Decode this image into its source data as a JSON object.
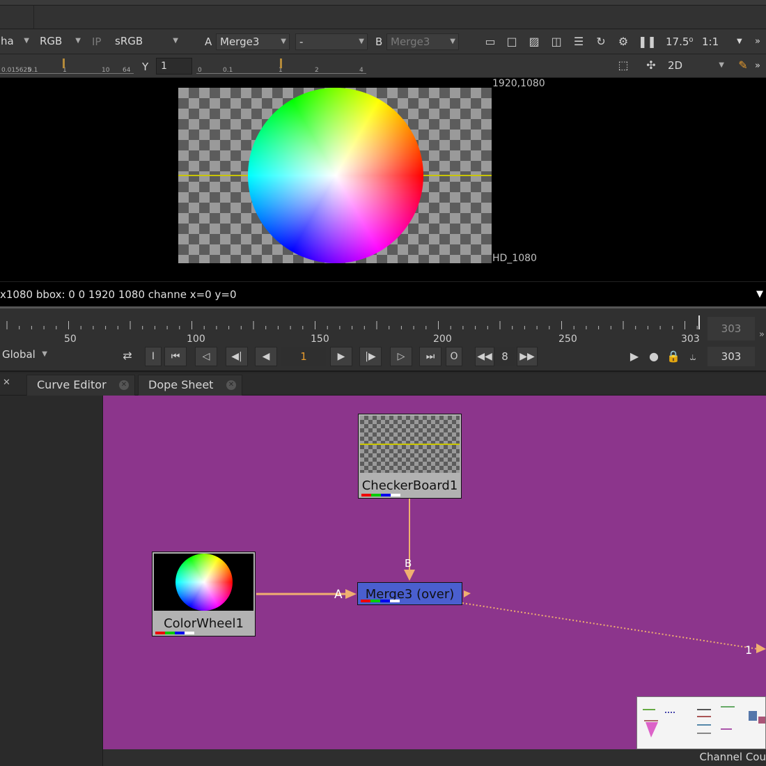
{
  "toolbar": {
    "channel_label": "ha",
    "rgb": "RGB",
    "ip": "IP",
    "colorspace": "sRGB",
    "a_label": "A",
    "a_input": "Merge3",
    "op": "-",
    "b_label": "B",
    "b_input": "Merge3",
    "zoom": "17.5⁰",
    "ratio": "1:1"
  },
  "toolbar2": {
    "gain_ruler": [
      "0.015625",
      "0.1",
      "1",
      "10",
      "64"
    ],
    "gamma_label": "Y",
    "gamma_value": "1",
    "gamma_ruler": [
      "0",
      "0.1",
      "1",
      "2",
      "4"
    ],
    "view_mode": "2D"
  },
  "viewer": {
    "top_right_label": "1920,1080",
    "format_label": "HD_1080"
  },
  "infobar": {
    "text": "x1080  bbox: 0 0 1920 1080 channe  x=0 y=0"
  },
  "timeline": {
    "labels": [
      "50",
      "100",
      "150",
      "200",
      "250",
      "303"
    ],
    "end_frame": "303"
  },
  "playbar": {
    "scope": "Global",
    "current_frame": "1",
    "increment": "8",
    "end_frame": "303"
  },
  "tabs": [
    {
      "label": "Curve Editor"
    },
    {
      "label": "Dope Sheet"
    }
  ],
  "nodes": {
    "checkerboard": "CheckerBoard1",
    "colorwheel": "ColorWheel1",
    "merge": "Merge3 (over)",
    "input_a": "A",
    "input_b": "B",
    "output_label": "1"
  },
  "status": {
    "channel_count": "Channel Cou"
  },
  "colors": {
    "dag_bg": "#8c358c",
    "pipe": "#f0b070",
    "merge_node": "#4a5fcf",
    "accent_orange": "#e59a2e"
  }
}
